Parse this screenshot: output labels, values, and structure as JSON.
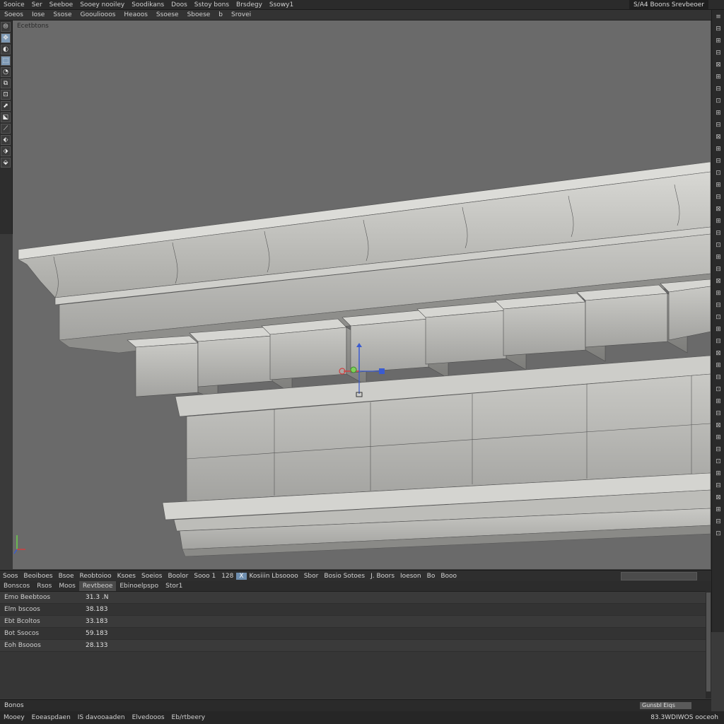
{
  "menubar": {
    "items": [
      "Sooice",
      "Ser",
      "Seeboe",
      "Sooey nooiley",
      "Soodikans",
      "Doos",
      "Sstoy bons",
      "Brsdegy",
      "Ssowy1"
    ],
    "right_label": "S/A4",
    "right_text": "Boons Srevbeoer"
  },
  "toolbar2": {
    "items": [
      "Soeos",
      "Iose",
      "Ssose",
      "Goouliooos",
      "Heaoos",
      "Ssoese",
      "Sboese",
      "b",
      "Srovei"
    ]
  },
  "viewport": {
    "label": "Ecetbtons"
  },
  "left_tools": [
    "⦾",
    "✥",
    "◐",
    "⬚",
    "◔",
    "⧉",
    "⊡",
    "⬈",
    "⬕",
    "⟋",
    "⬖",
    "⬗",
    "⬙"
  ],
  "right_icons": [
    "≡",
    "⊟",
    "⊞",
    "⊟",
    "⊠",
    "⊞",
    "⊟",
    "⊡",
    "⊞",
    "⊟",
    "⊠",
    "⊞",
    "⊟",
    "⊡",
    "⊞",
    "⊟",
    "⊠",
    "⊞",
    "⊟",
    "⊡",
    "⊞",
    "⊟",
    "⊠",
    "⊞",
    "⊟",
    "⊡",
    "⊞",
    "⊟",
    "⊠",
    "⊞",
    "⊟",
    "⊡",
    "⊞",
    "⊟",
    "⊠",
    "⊞",
    "⊟",
    "⊡",
    "⊞",
    "⊟",
    "⊠",
    "⊞",
    "⊟",
    "⊡"
  ],
  "timeline": {
    "items": [
      "Soos",
      "Beoiboes",
      "Bsoe",
      "Reobtoioo",
      "Ksoes",
      "Soeios",
      "Boolor",
      "Sooo 1",
      "128"
    ],
    "highlight_icon": "X",
    "items2": [
      "Kosiiin Lbsoooo",
      "Sbor",
      "Bosio Sotoes",
      "J. Boors",
      "Ioeson",
      "Bo",
      "Booo"
    ],
    "search_placeholder": ""
  },
  "panel": {
    "tabs": [
      "Bonscos",
      "Rsos",
      "Moos",
      "Revtbeoe",
      "Ebinoelpspo",
      "Stor1"
    ],
    "active_tab": 3,
    "rows": [
      {
        "key": "Emo Beebtoos",
        "value": "31.3 .N"
      },
      {
        "key": "Elm bscoos",
        "value": "38.183"
      },
      {
        "key": "Ebt Bcoltos",
        "value": "33.183"
      },
      {
        "key": "Bot Ssocos",
        "value": "59.183"
      },
      {
        "key": "Eoh Bsooos",
        "value": "28.133"
      }
    ]
  },
  "status1": {
    "label": "Bonos",
    "box_text": "Gunsbl Eiqs"
  },
  "status2": {
    "items": [
      "Mooey",
      "Eoeaspdaen",
      "IS davooaaden",
      "Elvedooos",
      "Eb/rtbeery"
    ],
    "right_text": "83.3WDIWOS ooceoh"
  }
}
